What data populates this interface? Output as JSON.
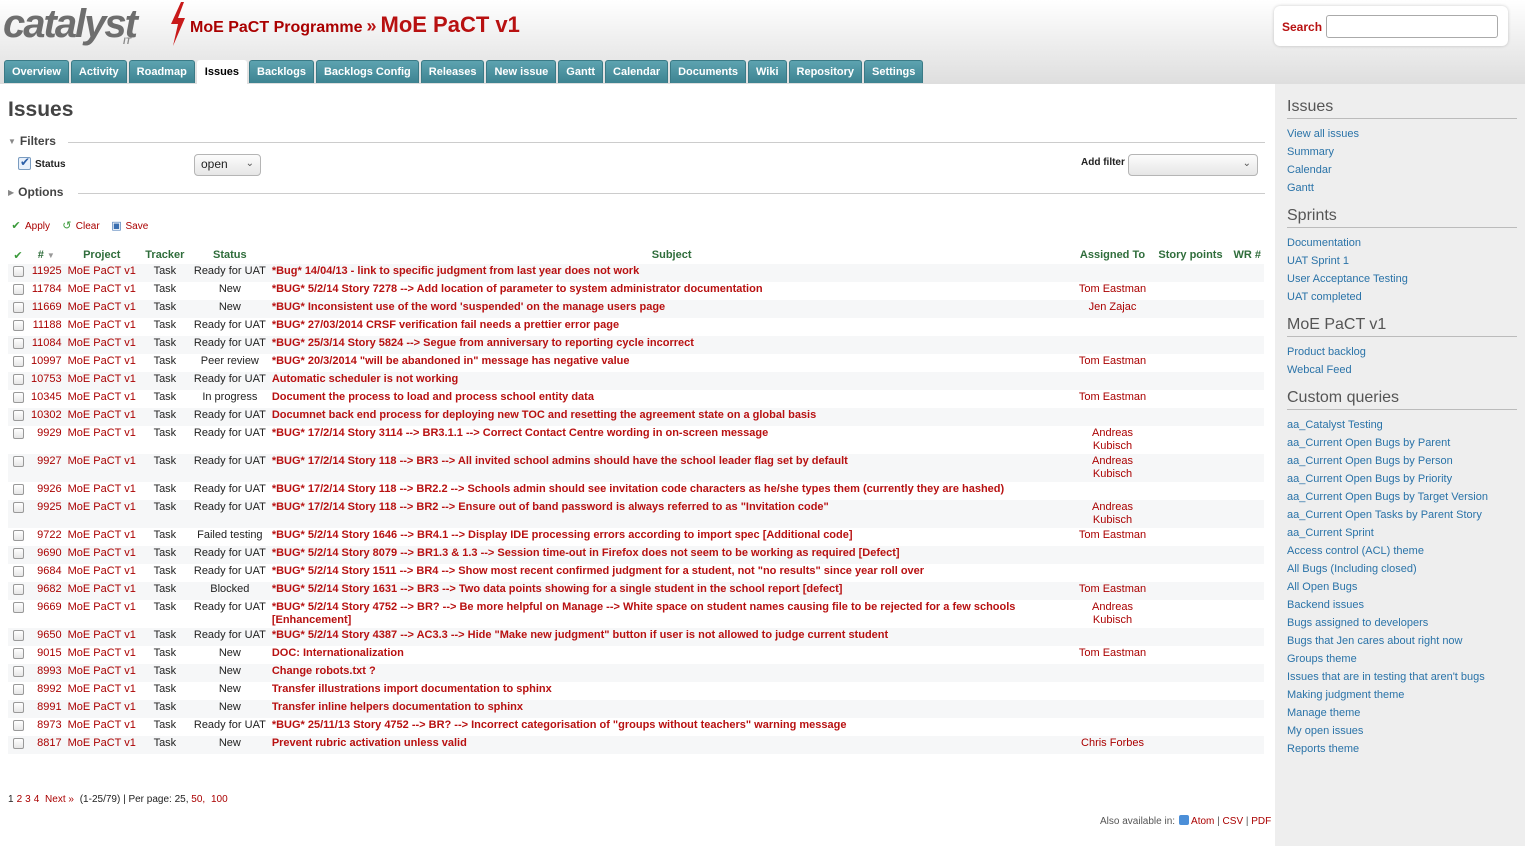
{
  "header": {
    "logo_text": "catalyst",
    "logo_sub": "IT",
    "parent_project": "MoE PaCT Programme",
    "separator": "»",
    "project": "MoE PaCT v1",
    "search_label": "Search",
    "search_value": ""
  },
  "tabs": [
    "Overview",
    "Activity",
    "Roadmap",
    "Issues",
    "Backlogs",
    "Backlogs Config",
    "Releases",
    "New issue",
    "Gantt",
    "Calendar",
    "Documents",
    "Wiki",
    "Repository",
    "Settings"
  ],
  "selected_tab": "Issues",
  "main": {
    "title": "Issues",
    "filters_legend": "Filters",
    "options_legend": "Options",
    "status_label": "Status",
    "status_value": "open",
    "add_filter_label": "Add filter",
    "add_filter_value": "",
    "apply": "Apply",
    "clear": "Clear",
    "save": "Save"
  },
  "columns": {
    "check": "✔",
    "id": "#",
    "project": "Project",
    "tracker": "Tracker",
    "status": "Status",
    "subject": "Subject",
    "assigned": "Assigned To",
    "story_points": "Story points",
    "wr": "WR #"
  },
  "issues": [
    {
      "id": "11925",
      "project": "MoE PaCT v1",
      "tracker": "Task",
      "status": "Ready for UAT",
      "subject": "*Bug* 14/04/13 - link to specific judgment from last year does not work",
      "assigned": ""
    },
    {
      "id": "11784",
      "project": "MoE PaCT v1",
      "tracker": "Task",
      "status": "New",
      "subject": "*BUG* 5/2/14 Story 7278 --> Add location of parameter to system administrator documentation",
      "assigned": "Tom Eastman"
    },
    {
      "id": "11669",
      "project": "MoE PaCT v1",
      "tracker": "Task",
      "status": "New",
      "subject": "*BUG* Inconsistent use of the word 'suspended' on the manage users page",
      "assigned": "Jen Zajac"
    },
    {
      "id": "11188",
      "project": "MoE PaCT v1",
      "tracker": "Task",
      "status": "Ready for UAT",
      "subject": "*BUG* 27/03/2014 CRSF verification fail needs a prettier error page",
      "assigned": ""
    },
    {
      "id": "11084",
      "project": "MoE PaCT v1",
      "tracker": "Task",
      "status": "Ready for UAT",
      "subject": "*BUG* 25/3/14 Story 5824 --> Segue from anniversary to reporting cycle incorrect",
      "assigned": ""
    },
    {
      "id": "10997",
      "project": "MoE PaCT v1",
      "tracker": "Task",
      "status": "Peer review",
      "subject": "*BUG* 20/3/2014 \"will be abandoned in\" message has negative value",
      "assigned": "Tom Eastman"
    },
    {
      "id": "10753",
      "project": "MoE PaCT v1",
      "tracker": "Task",
      "status": "Ready for UAT",
      "subject": "Automatic scheduler is not working",
      "assigned": ""
    },
    {
      "id": "10345",
      "project": "MoE PaCT v1",
      "tracker": "Task",
      "status": "In progress",
      "subject": "Document the process to load and process school entity data",
      "assigned": "Tom Eastman"
    },
    {
      "id": "10302",
      "project": "MoE PaCT v1",
      "tracker": "Task",
      "status": "Ready for UAT",
      "subject": "Documnet back end process for deploying new TOC and resetting the agreement state on a global basis",
      "assigned": ""
    },
    {
      "id": "9929",
      "project": "MoE PaCT v1",
      "tracker": "Task",
      "status": "Ready for UAT",
      "subject": "*BUG* 17/2/14 Story 3114 --> BR3.1.1 --> Correct Contact Centre wording in on-screen message",
      "assigned": "Andreas Kubisch"
    },
    {
      "id": "9927",
      "project": "MoE PaCT v1",
      "tracker": "Task",
      "status": "Ready for UAT",
      "subject": "*BUG* 17/2/14 Story 118 --> BR3 --> All invited school admins should have the school leader flag set by default",
      "assigned": "Andreas Kubisch"
    },
    {
      "id": "9926",
      "project": "MoE PaCT v1",
      "tracker": "Task",
      "status": "Ready for UAT",
      "subject": "*BUG* 17/2/14 Story 118 --> BR2.2 --> Schools admin should see invitation code characters as he/she types them (currently they are hashed)",
      "assigned": ""
    },
    {
      "id": "9925",
      "project": "MoE PaCT v1",
      "tracker": "Task",
      "status": "Ready for UAT",
      "subject": "*BUG* 17/2/14 Story 118 --> BR2 --> Ensure out of band password is always referred to as \"Invitation code\"",
      "assigned": "Andreas Kubisch"
    },
    {
      "id": "9722",
      "project": "MoE PaCT v1",
      "tracker": "Task",
      "status": "Failed testing",
      "subject": "*BUG* 5/2/14 Story 1646 --> BR4.1 --> Display IDE processing errors according to import spec [Additional code]",
      "assigned": "Tom Eastman"
    },
    {
      "id": "9690",
      "project": "MoE PaCT v1",
      "tracker": "Task",
      "status": "Ready for UAT",
      "subject": "*BUG* 5/2/14 Story 8079 --> BR1.3 & 1.3 --> Session time-out in Firefox does not seem to be working as required [Defect]",
      "assigned": ""
    },
    {
      "id": "9684",
      "project": "MoE PaCT v1",
      "tracker": "Task",
      "status": "Ready for UAT",
      "subject": "*BUG* 5/2/14 Story 1511 --> BR4 --> Show most recent confirmed judgment for a student, not \"no results\" since year roll over",
      "assigned": ""
    },
    {
      "id": "9682",
      "project": "MoE PaCT v1",
      "tracker": "Task",
      "status": "Blocked",
      "subject": "*BUG* 5/2/14 Story 1631 --> BR3 --> Two data points showing for a single student in the school report [defect]",
      "assigned": "Tom Eastman"
    },
    {
      "id": "9669",
      "project": "MoE PaCT v1",
      "tracker": "Task",
      "status": "Ready for UAT",
      "subject": "*BUG* 5/2/14 Story 4752 --> BR? --> Be more helpful on Manage --> White space on student names causing file to be rejected for a few schools [Enhancement]",
      "assigned": "Andreas Kubisch"
    },
    {
      "id": "9650",
      "project": "MoE PaCT v1",
      "tracker": "Task",
      "status": "Ready for UAT",
      "subject": "*BUG* 5/2/14 Story 4387 --> AC3.3 --> Hide \"Make new judgment\" button if user is not allowed to judge current student",
      "assigned": ""
    },
    {
      "id": "9015",
      "project": "MoE PaCT v1",
      "tracker": "Task",
      "status": "New",
      "subject": "DOC: Internationalization",
      "assigned": "Tom Eastman"
    },
    {
      "id": "8993",
      "project": "MoE PaCT v1",
      "tracker": "Task",
      "status": "New",
      "subject": "Change robots.txt ?",
      "assigned": ""
    },
    {
      "id": "8992",
      "project": "MoE PaCT v1",
      "tracker": "Task",
      "status": "New",
      "subject": "Transfer illustrations import documentation to sphinx",
      "assigned": ""
    },
    {
      "id": "8991",
      "project": "MoE PaCT v1",
      "tracker": "Task",
      "status": "New",
      "subject": "Transfer inline helpers documentation to sphinx",
      "assigned": ""
    },
    {
      "id": "8973",
      "project": "MoE PaCT v1",
      "tracker": "Task",
      "status": "Ready for UAT",
      "subject": "*BUG* 25/11/13 Story 4752 --> BR? --> Incorrect categorisation of \"groups without teachers\" warning message",
      "assigned": ""
    },
    {
      "id": "8817",
      "project": "MoE PaCT v1",
      "tracker": "Task",
      "status": "New",
      "subject": "Prevent rubric activation unless valid",
      "assigned": "Chris Forbes"
    }
  ],
  "pagination": {
    "pages": [
      "1",
      "2",
      "3",
      "4"
    ],
    "next": "Next »",
    "range": "(1-25/79)",
    "per_page_label": "| Per page:",
    "per_page_current": "25,",
    "per_page_options": [
      "50,",
      "100"
    ]
  },
  "formats": {
    "label": "Also available in:",
    "atom": "Atom",
    "csv": "CSV",
    "pdf": "PDF"
  },
  "sidebar": {
    "issues_title": "Issues",
    "issues_links": [
      "View all issues",
      "Summary",
      "Calendar",
      "Gantt"
    ],
    "sprints_title": "Sprints",
    "sprints_links": [
      "Documentation",
      "UAT Sprint 1",
      "User Acceptance Testing",
      "UAT completed"
    ],
    "project_title": "MoE PaCT v1",
    "project_links": [
      "Product backlog",
      "Webcal Feed"
    ],
    "queries_title": "Custom queries",
    "queries_links": [
      "aa_Catalyst Testing",
      "aa_Current Open Bugs by Parent",
      "aa_Current Open Bugs by Person",
      "aa_Current Open Bugs by Priority",
      "aa_Current Open Bugs by Target Version",
      "aa_Current Open Tasks by Parent Story",
      "aa_Current Sprint",
      "Access control (ACL) theme",
      "All Bugs (Including closed)",
      "All Open Bugs",
      "Backend issues",
      "Bugs assigned to developers",
      "Bugs that Jen cares about right now",
      "Groups theme",
      "Issues that are in testing that aren't bugs",
      "Making judgment theme",
      "Manage theme",
      "My open issues",
      "Reports theme"
    ]
  },
  "colors": {
    "brand_red": "#b81111",
    "tab_bg": "#4a8f9c",
    "link_blue": "#2a73a8",
    "header_green": "#2f6d3b"
  }
}
